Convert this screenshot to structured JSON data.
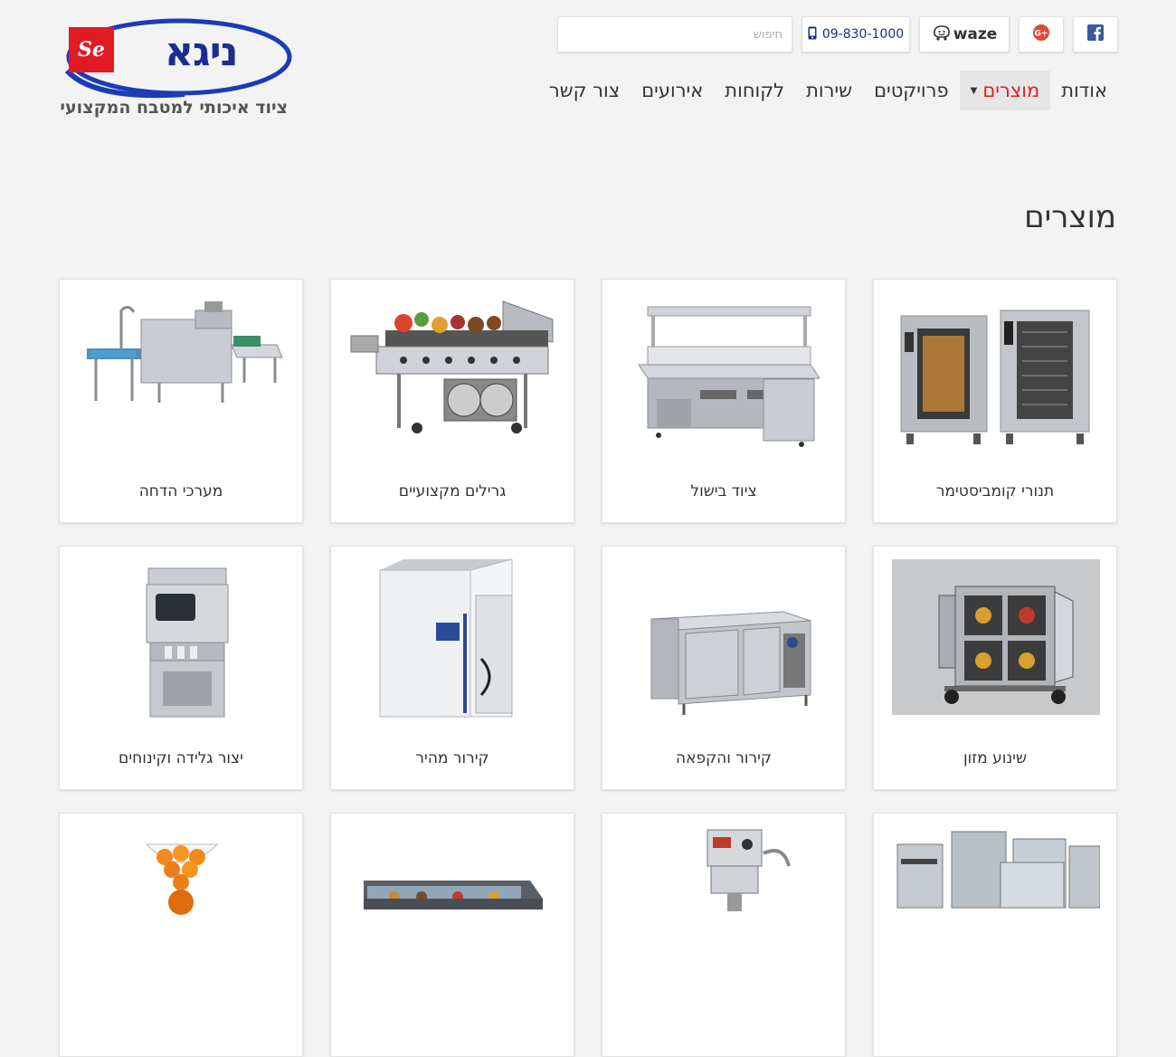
{
  "header": {
    "logo": {
      "brand": "ניגא",
      "mark": "Se",
      "tagline": "ציוד איכותי למטבח המקצועי"
    },
    "search": {
      "placeholder": "חיפוש",
      "value": ""
    },
    "phone": "09-830-1000",
    "waze_label": "waze",
    "social": {
      "gplus_icon": "google-plus-icon",
      "facebook_icon": "facebook-icon"
    }
  },
  "nav": {
    "items": [
      {
        "label": "אודות",
        "active": false
      },
      {
        "label": "מוצרים",
        "active": true,
        "dropdown": true
      },
      {
        "label": "פרויקטים",
        "active": false
      },
      {
        "label": "שירות",
        "active": false
      },
      {
        "label": "לקוחות",
        "active": false
      },
      {
        "label": "אירועים",
        "active": false
      },
      {
        "label": "צור קשר",
        "active": false
      }
    ]
  },
  "main": {
    "title": "מוצרים",
    "products": [
      {
        "label": "תנורי קומביסטימר",
        "icon": "combi-oven-image"
      },
      {
        "label": "ציוד בישול",
        "icon": "cooking-equipment-image"
      },
      {
        "label": "גרילים מקצועיים",
        "icon": "grill-image"
      },
      {
        "label": "מערכי הדחה",
        "icon": "dishwasher-image"
      },
      {
        "label": "שינוע מזון",
        "icon": "food-transport-cart-image"
      },
      {
        "label": "קירור והקפאה",
        "icon": "refrigerated-counter-image"
      },
      {
        "label": "קירור מהיר",
        "icon": "blast-chiller-image"
      },
      {
        "label": "יצור גלידה וקינוחים",
        "icon": "soft-serve-machine-image"
      },
      {
        "label": "",
        "icon": "ice-machine-image"
      },
      {
        "label": "",
        "icon": "mixer-image"
      },
      {
        "label": "",
        "icon": "display-case-image"
      },
      {
        "label": "",
        "icon": "juicer-image"
      }
    ]
  },
  "colors": {
    "accent": "#e01b24",
    "brand_blue": "#1c2d8f",
    "background": "#f3f3f3"
  }
}
